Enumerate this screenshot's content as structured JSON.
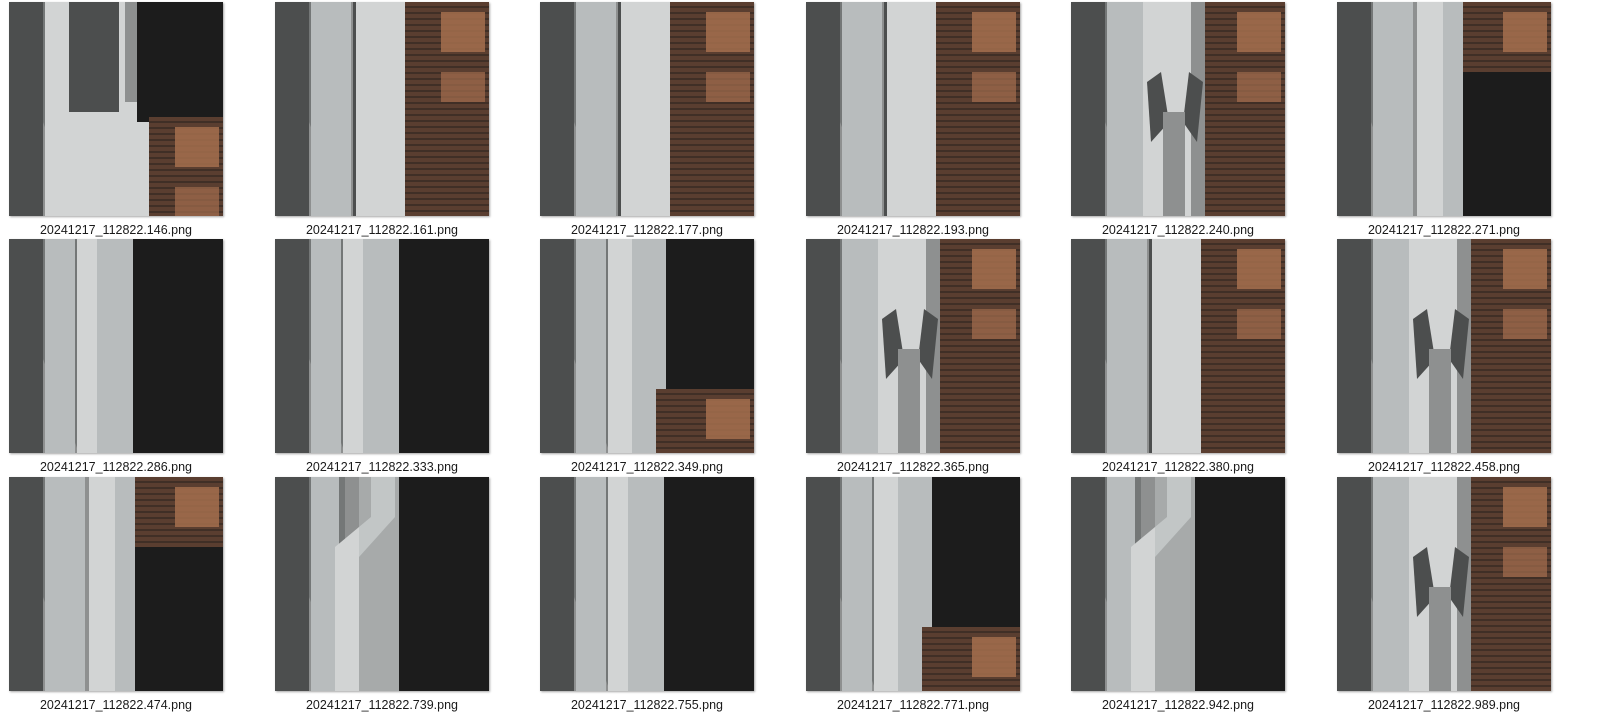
{
  "files": [
    {
      "name": "20241217_112822.146.png",
      "kind": "chip-left"
    },
    {
      "name": "20241217_112822.161.png",
      "kind": "pads-right"
    },
    {
      "name": "20241217_112822.177.png",
      "kind": "pads-right"
    },
    {
      "name": "20241217_112822.193.png",
      "kind": "pads-right"
    },
    {
      "name": "20241217_112822.240.png",
      "kind": "pads-taper"
    },
    {
      "name": "20241217_112822.271.png",
      "kind": "pads-dark"
    },
    {
      "name": "20241217_112822.286.png",
      "kind": "dark-right"
    },
    {
      "name": "20241217_112822.333.png",
      "kind": "dark-right"
    },
    {
      "name": "20241217_112822.349.png",
      "kind": "dark-pads-bottom"
    },
    {
      "name": "20241217_112822.365.png",
      "kind": "pads-taper"
    },
    {
      "name": "20241217_112822.380.png",
      "kind": "pads-right"
    },
    {
      "name": "20241217_112822.458.png",
      "kind": "pads-taper"
    },
    {
      "name": "20241217_112822.474.png",
      "kind": "pads-dark"
    },
    {
      "name": "20241217_112822.739.png",
      "kind": "bend-dark"
    },
    {
      "name": "20241217_112822.755.png",
      "kind": "dark-right"
    },
    {
      "name": "20241217_112822.771.png",
      "kind": "dark-pads-bottom"
    },
    {
      "name": "20241217_112822.942.png",
      "kind": "bend-dark"
    },
    {
      "name": "20241217_112822.989.png",
      "kind": "pads-taper"
    }
  ],
  "colors": {
    "metal": "#b8bcbd",
    "light_metal": "#d2d4d4",
    "gray": "#8e9090",
    "dark_gray": "#6a6c6c",
    "darker": "#4c4e4e",
    "black": "#1c1c1c",
    "copper": "#a46e4e",
    "copper_dark": "#5a3e30",
    "pad_line": "#3a2c24"
  }
}
